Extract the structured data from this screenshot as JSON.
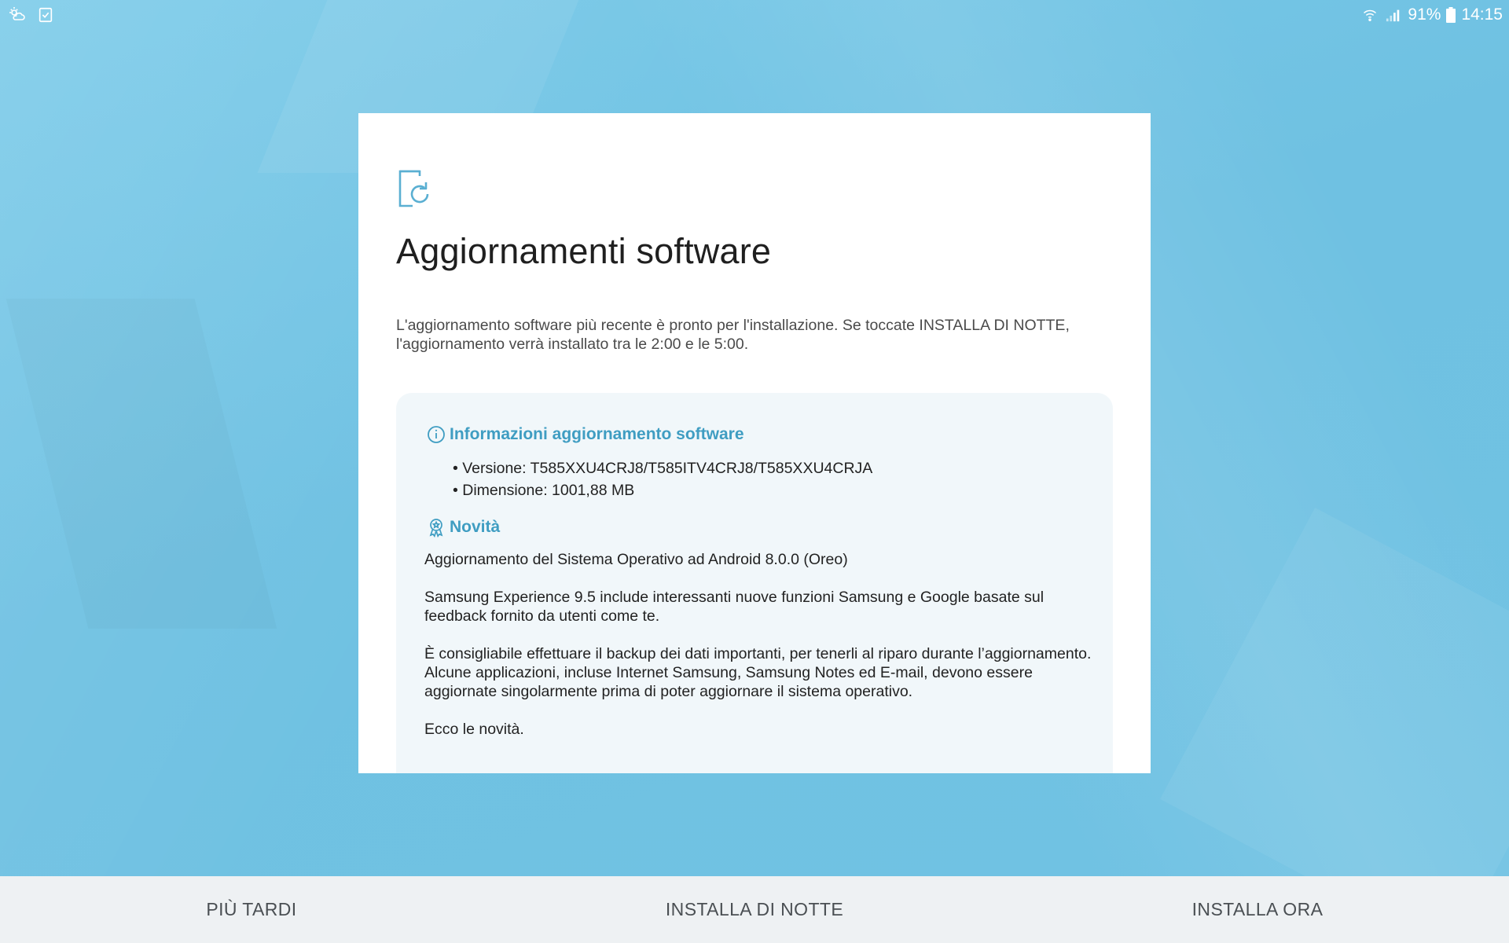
{
  "status_bar": {
    "battery": "91%",
    "time": "14:15",
    "left_icons": [
      "weather-icon",
      "task-check-icon"
    ],
    "right_icons": [
      "wifi-icon",
      "signal-icon",
      "battery-icon"
    ]
  },
  "dialog": {
    "icon": "software-update-icon",
    "title": "Aggiornamenti software",
    "intro": "L'aggiornamento software più recente è pronto per l'installazione. Se toccate INSTALLA DI NOTTE, l'aggiornamento verrà installato tra le 2:00 e le 5:00.",
    "info": {
      "heading": "Informazioni aggiornamento software",
      "version": "Versione: T585XXU4CRJ8/T585ITV4CRJ8/T585XXU4CRJA",
      "size": "Dimensione: 1001,88 MB"
    },
    "news": {
      "heading": "Novità",
      "p1": "Aggiornamento del Sistema Operativo ad Android 8.0.0 (Oreo)",
      "p2": "Samsung Experience 9.5 include interessanti nuove funzioni Samsung e Google basate sul feedback fornito da utenti come te.",
      "p3": "È consigliabile effettuare il backup dei dati importanti, per tenerli al riparo durante l’aggiornamento.",
      "p4": "Alcune applicazioni, incluse Internet Samsung, Samsung Notes ed E-mail, devono essere aggiornate singolarmente prima di poter aggiornare il sistema operativo.",
      "p5": "Ecco le novità."
    }
  },
  "actions": {
    "later": "PIÙ TARDI",
    "tonight": "INSTALLA DI NOTTE",
    "now": "INSTALLA ORA"
  },
  "colors": {
    "accent": "#3f9dc2",
    "wallpaper": "#74c3e2",
    "bottom_bar": "#eef1f3"
  }
}
